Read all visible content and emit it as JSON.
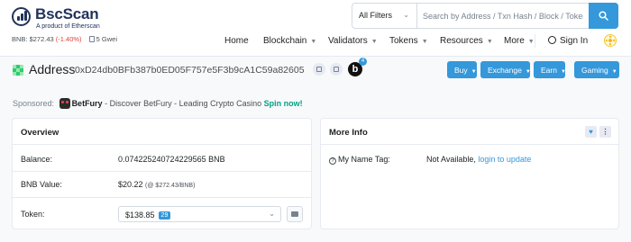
{
  "brand": {
    "name": "BscScan",
    "tagline": "A product of Etherscan"
  },
  "search": {
    "filter": "All Filters",
    "placeholder": "Search by Address / Txn Hash / Block / Token"
  },
  "ticker": {
    "price": "BNB: $272.43",
    "change": "(-1.40%)",
    "gas": "5 Gwei"
  },
  "nav": {
    "home": "Home",
    "blockchain": "Blockchain",
    "validators": "Validators",
    "tokens": "Tokens",
    "resources": "Resources",
    "more": "More",
    "signin": "Sign In"
  },
  "address": {
    "label": "Address",
    "hash": "0xD24db0BFb387b0ED05F757e5F3b9cA1C59a82605",
    "badge_letter": "b",
    "badge_count": "4"
  },
  "actions": {
    "buy": "Buy",
    "exchange": "Exchange",
    "earn": "Earn",
    "gaming": "Gaming"
  },
  "sponsored": {
    "label": "Sponsored:",
    "name": "BetFury",
    "text": " - Discover BetFury - Leading Crypto Casino ",
    "cta": "Spin now!"
  },
  "overview": {
    "title": "Overview",
    "balance_label": "Balance:",
    "balance_value": "0.074225240724229565 BNB",
    "bnb_value_label": "BNB Value:",
    "bnb_value": "$20.22",
    "bnb_value_sub": "(@ $272.43/BNB)",
    "token_label": "Token:",
    "token_value": "$138.85",
    "token_count": "29"
  },
  "more_info": {
    "title": "More Info",
    "name_tag_label": "My Name Tag:",
    "name_tag_value": "Not Available,",
    "name_tag_link": "login to update"
  },
  "colors": {
    "accent": "#3498db",
    "negative": "#de4437",
    "sponsor_cta": "#00a186"
  }
}
